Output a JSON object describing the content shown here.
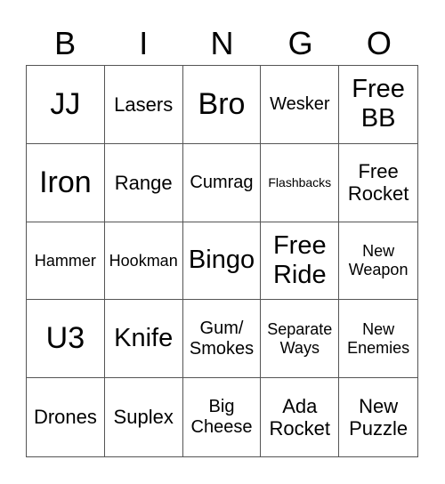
{
  "header": [
    "B",
    "I",
    "N",
    "G",
    "O"
  ],
  "cells": [
    {
      "text": "JJ",
      "size": "s-xl"
    },
    {
      "text": "Lasers",
      "size": "s-m"
    },
    {
      "text": "Bro",
      "size": "s-xl"
    },
    {
      "text": "Wesker",
      "size": "s-ms"
    },
    {
      "text": "Free BB",
      "size": "s-l"
    },
    {
      "text": "Iron",
      "size": "s-xl"
    },
    {
      "text": "Range",
      "size": "s-m"
    },
    {
      "text": "Cumrag",
      "size": "s-ms"
    },
    {
      "text": "Flashbacks",
      "size": "s-xs"
    },
    {
      "text": "Free Rocket",
      "size": "s-m"
    },
    {
      "text": "Hammer",
      "size": "s-s"
    },
    {
      "text": "Hookman",
      "size": "s-s"
    },
    {
      "text": "Bingo",
      "size": "s-l"
    },
    {
      "text": "Free Ride",
      "size": "s-l"
    },
    {
      "text": "New Weapon",
      "size": "s-s"
    },
    {
      "text": "U3",
      "size": "s-xl"
    },
    {
      "text": "Knife",
      "size": "s-l"
    },
    {
      "text": "Gum/ Smokes",
      "size": "s-ms"
    },
    {
      "text": "Separate Ways",
      "size": "s-s"
    },
    {
      "text": "New Enemies",
      "size": "s-s"
    },
    {
      "text": "Drones",
      "size": "s-m"
    },
    {
      "text": "Suplex",
      "size": "s-m"
    },
    {
      "text": "Big Cheese",
      "size": "s-ms"
    },
    {
      "text": "Ada Rocket",
      "size": "s-m"
    },
    {
      "text": "New Puzzle",
      "size": "s-m"
    }
  ]
}
